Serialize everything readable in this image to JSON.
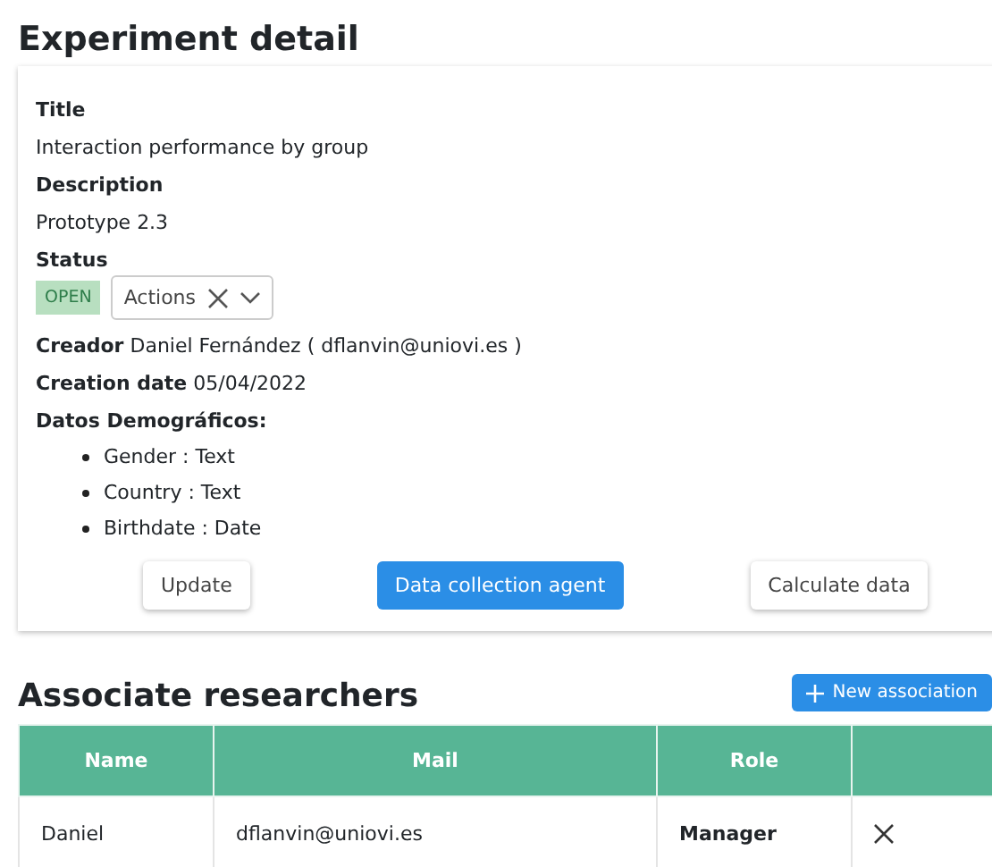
{
  "page_title": "Experiment detail",
  "fields": [
    {
      "label": "Title",
      "value": "Interaction performance by group"
    },
    {
      "label": "Description",
      "value": "Prototype 2.3"
    }
  ],
  "status": {
    "label": "Status",
    "badge": "OPEN",
    "actions": "Actions"
  },
  "creator": "**Creador** Daniel Fernández ( dflanvin@uniovi.es )",
  "creation_date": "**Creation date** 05/04/2022",
  "demographics": {
    "label": "Datos Demográficos:",
    "items": [
      "Gender : Text",
      "Country : Text",
      "Birthdate : Date"
    ]
  },
  "buttons": [
    {
      "label": "Update",
      "kind": "default"
    },
    {
      "label": "Data collection agent",
      "kind": "primary"
    },
    {
      "label": "Calculate data",
      "kind": "default"
    }
  ],
  "researchers": {
    "title": "Associate researchers",
    "new_button": "New association",
    "columns": [
      "Name",
      "Mail",
      "Role"
    ],
    "rows": [
      {
        "name": "Daniel",
        "mail": "dflanvin@uniovi.es",
        "role": "Manager"
      }
    ]
  }
}
